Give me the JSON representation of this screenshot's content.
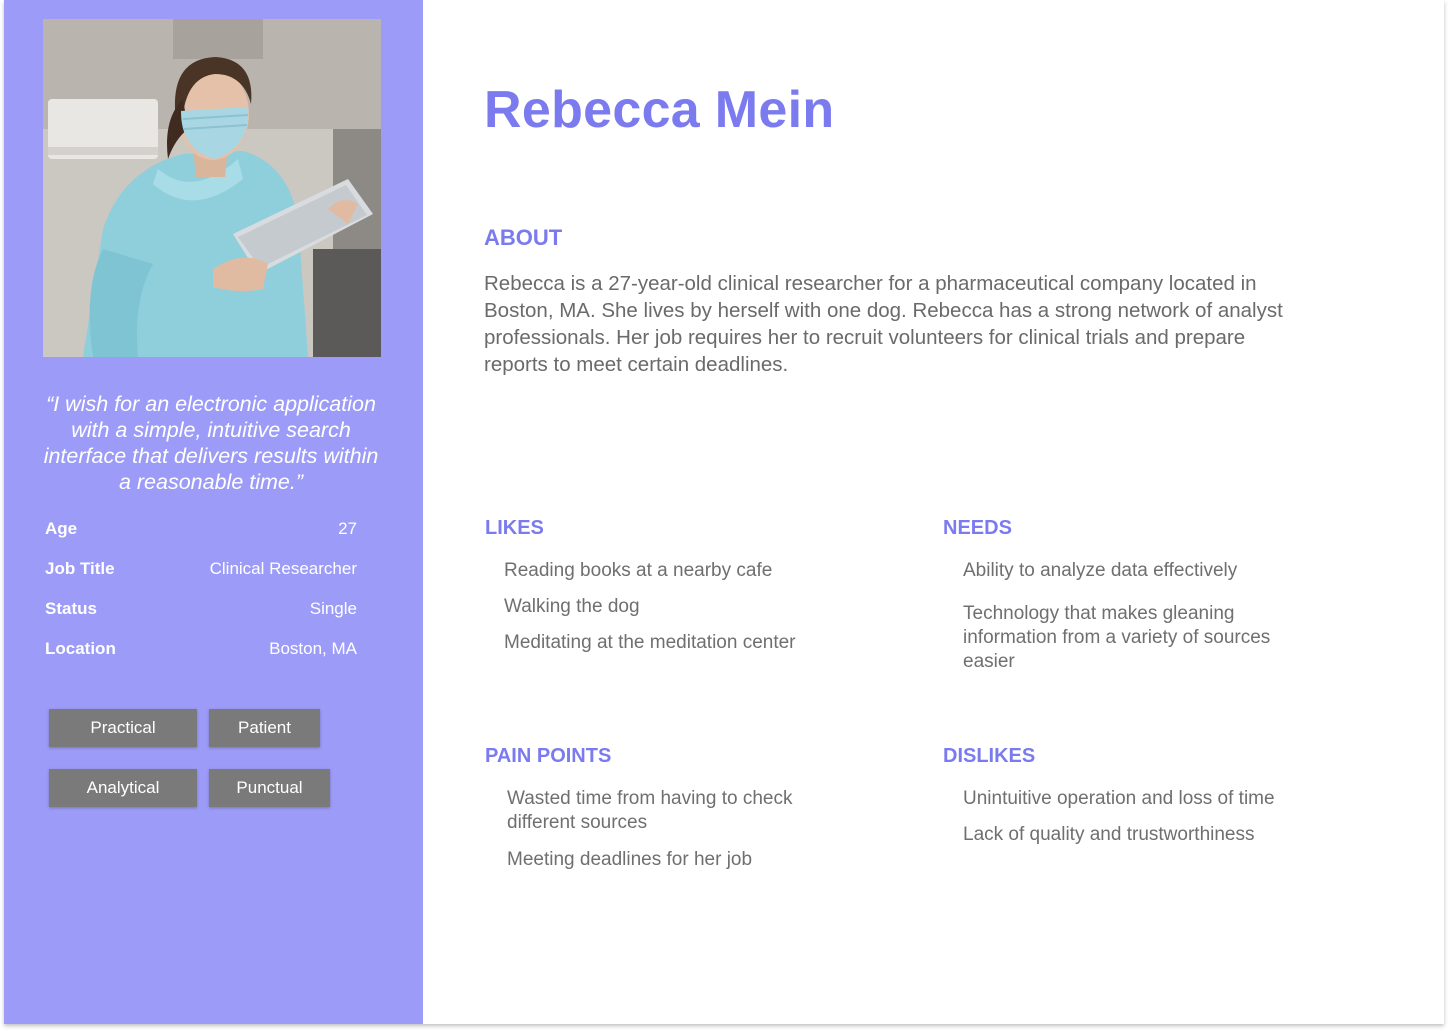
{
  "persona": {
    "name": "Rebecca Mein",
    "quote": "“I wish for an electronic application with a simple, intuitive search interface that delivers results within a reasonable time.”",
    "facts": [
      {
        "label": "Age",
        "value": "27"
      },
      {
        "label": "Job Title",
        "value": "Clinical Researcher"
      },
      {
        "label": "Status",
        "value": "Single"
      },
      {
        "label": "Location",
        "value": "Boston, MA"
      }
    ],
    "traits": [
      "Practical",
      "Patient",
      "Analytical",
      "Punctual"
    ]
  },
  "about": {
    "heading": "ABOUT",
    "text": "Rebecca is a 27-year-old clinical researcher for a pharmaceutical company located in Boston, MA. She lives by herself with one dog. Rebecca has a strong network of analyst professionals. Her job requires her to recruit volunteers for clinical trials and prepare reports to meet certain deadlines."
  },
  "likes": {
    "heading": "LIKES",
    "items": [
      "Reading books at a nearby cafe",
      "Walking the dog",
      "Meditating at the meditation center"
    ]
  },
  "needs": {
    "heading": "NEEDS",
    "items": [
      "Ability to analyze data effectively",
      "Technology that makes gleaning information from a variety of sources easier"
    ]
  },
  "pain_points": {
    "heading": "PAIN POINTS",
    "items": [
      "Wasted time from having to check different sources",
      "Meeting deadlines for her job"
    ]
  },
  "dislikes": {
    "heading": "DISLIKES",
    "items": [
      "Unintuitive operation and loss of time",
      "Lack of quality and trustworthiness"
    ]
  },
  "colors": {
    "sidebar": "#9c9cf8",
    "accent": "#7b7bef",
    "tag": "#7a7a7a",
    "body_text": "#6a6a6a"
  },
  "photo": {
    "subject": "woman-in-scrubs-with-face-mask-holding-tablet"
  }
}
